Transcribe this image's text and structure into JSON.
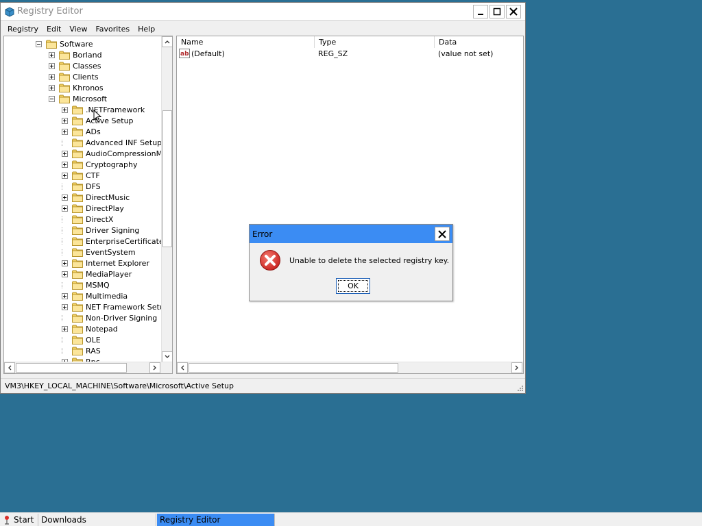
{
  "window": {
    "title": "Registry Editor"
  },
  "menu": [
    "Registry",
    "Edit",
    "View",
    "Favorites",
    "Help"
  ],
  "tree": [
    {
      "label": "Software",
      "depth": 0,
      "expander": "minus"
    },
    {
      "label": "Borland",
      "depth": 1,
      "expander": "plus"
    },
    {
      "label": "Classes",
      "depth": 1,
      "expander": "plus"
    },
    {
      "label": "Clients",
      "depth": 1,
      "expander": "plus"
    },
    {
      "label": "Khronos",
      "depth": 1,
      "expander": "plus"
    },
    {
      "label": "Microsoft",
      "depth": 1,
      "expander": "minus"
    },
    {
      "label": ".NETFramework",
      "depth": 2,
      "expander": "plus"
    },
    {
      "label": "Active Setup",
      "depth": 2,
      "expander": "plus"
    },
    {
      "label": "ADs",
      "depth": 2,
      "expander": "plus"
    },
    {
      "label": "Advanced INF Setup",
      "depth": 2,
      "expander": "none"
    },
    {
      "label": "AudioCompressionMana",
      "depth": 2,
      "expander": "plus"
    },
    {
      "label": "Cryptography",
      "depth": 2,
      "expander": "plus"
    },
    {
      "label": "CTF",
      "depth": 2,
      "expander": "plus"
    },
    {
      "label": "DFS",
      "depth": 2,
      "expander": "none"
    },
    {
      "label": "DirectMusic",
      "depth": 2,
      "expander": "plus"
    },
    {
      "label": "DirectPlay",
      "depth": 2,
      "expander": "plus"
    },
    {
      "label": "DirectX",
      "depth": 2,
      "expander": "none"
    },
    {
      "label": "Driver Signing",
      "depth": 2,
      "expander": "none"
    },
    {
      "label": "EnterpriseCertificates",
      "depth": 2,
      "expander": "none"
    },
    {
      "label": "EventSystem",
      "depth": 2,
      "expander": "none"
    },
    {
      "label": "Internet Explorer",
      "depth": 2,
      "expander": "plus"
    },
    {
      "label": "MediaPlayer",
      "depth": 2,
      "expander": "plus"
    },
    {
      "label": "MSMQ",
      "depth": 2,
      "expander": "none"
    },
    {
      "label": "Multimedia",
      "depth": 2,
      "expander": "plus"
    },
    {
      "label": "NET Framework Setup",
      "depth": 2,
      "expander": "plus"
    },
    {
      "label": "Non-Driver Signing",
      "depth": 2,
      "expander": "none"
    },
    {
      "label": "Notepad",
      "depth": 2,
      "expander": "plus"
    },
    {
      "label": "OLE",
      "depth": 2,
      "expander": "none"
    },
    {
      "label": "RAS",
      "depth": 2,
      "expander": "none"
    },
    {
      "label": "Rpc",
      "depth": 2,
      "expander": "plus"
    }
  ],
  "list": {
    "columns": [
      "Name",
      "Type",
      "Data"
    ],
    "rows": [
      {
        "name": "(Default)",
        "type": "REG_SZ",
        "data": "(value not set)",
        "icon": "string-value-icon"
      }
    ]
  },
  "status": "VM3\\HKEY_LOCAL_MACHINE\\Software\\Microsoft\\Active Setup",
  "dialog": {
    "title": "Error",
    "message": "Unable to delete the selected registry key.",
    "ok_label": "OK",
    "icon": "error-icon"
  },
  "taskbar": {
    "start_label": "Start",
    "items": [
      "Downloads",
      "Registry Editor"
    ],
    "active_index": 1
  },
  "colors": {
    "desktop": "#2a6f93",
    "accent": "#3b8cf3",
    "folder": "#f5d365",
    "error": "#d9302c"
  }
}
